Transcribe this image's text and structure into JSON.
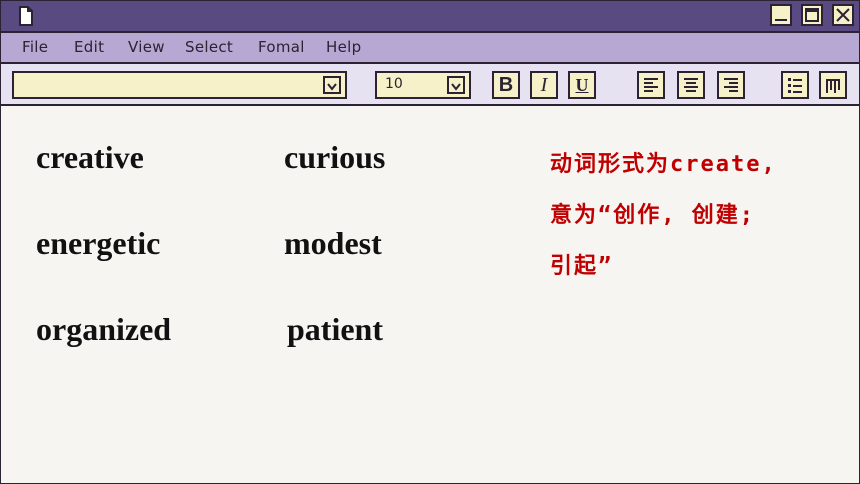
{
  "window": {
    "icon": "document-icon",
    "controls": [
      "minimize-icon",
      "maximize-icon",
      "close-icon"
    ]
  },
  "menu": {
    "file": "File",
    "edit": "Edit",
    "view": "View",
    "select": "Select",
    "format": "Fomal",
    "help": "Help"
  },
  "toolbar": {
    "font_value": "",
    "size_value": "10",
    "bold": "B",
    "italic": "I",
    "underline": "U",
    "icons": [
      "align-left-icon",
      "align-center-icon",
      "align-right-icon",
      "bullet-list-icon",
      "columns-icon"
    ]
  },
  "words": {
    "col1": [
      "creative",
      "energetic",
      "organized"
    ],
    "col2": [
      "curious",
      "modest",
      "patient"
    ]
  },
  "note": {
    "line1": "动词形式为create,",
    "line2": "意为“创作, 创建;",
    "line3": "引起”",
    "color": "#c00000"
  },
  "colors": {
    "titlebar": "#5a4a82",
    "menubar": "#b6a8d2",
    "toolbar": "#e7e2f1",
    "field": "#f6f1c8"
  }
}
